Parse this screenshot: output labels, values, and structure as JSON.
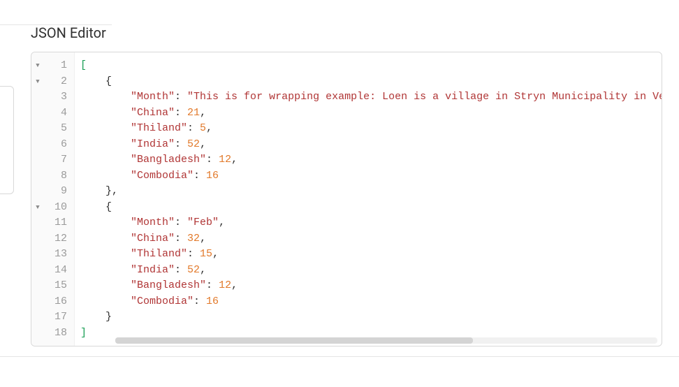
{
  "title": "JSON Editor",
  "lines": [
    {
      "n": 1,
      "fold": true,
      "ind": 0,
      "tokens": [
        {
          "t": "[",
          "c": "bracket"
        }
      ]
    },
    {
      "n": 2,
      "fold": true,
      "ind": 1,
      "tokens": [
        {
          "t": "{",
          "c": "brace"
        }
      ]
    },
    {
      "n": 3,
      "fold": false,
      "ind": 2,
      "tokens": [
        {
          "t": "\"Month\"",
          "c": "key"
        },
        {
          "t": ": ",
          "c": "punc"
        },
        {
          "t": "\"This is for wrapping example: Loen is a village in Stryn Municipality in Vestland county, Norway.\"",
          "c": "str"
        },
        {
          "t": ",",
          "c": "punc"
        }
      ]
    },
    {
      "n": 4,
      "fold": false,
      "ind": 2,
      "tokens": [
        {
          "t": "\"China\"",
          "c": "key"
        },
        {
          "t": ": ",
          "c": "punc"
        },
        {
          "t": "21",
          "c": "num"
        },
        {
          "t": ",",
          "c": "punc"
        }
      ]
    },
    {
      "n": 5,
      "fold": false,
      "ind": 2,
      "tokens": [
        {
          "t": "\"Thiland\"",
          "c": "key"
        },
        {
          "t": ": ",
          "c": "punc"
        },
        {
          "t": "5",
          "c": "num"
        },
        {
          "t": ",",
          "c": "punc"
        }
      ]
    },
    {
      "n": 6,
      "fold": false,
      "ind": 2,
      "tokens": [
        {
          "t": "\"India\"",
          "c": "key"
        },
        {
          "t": ": ",
          "c": "punc"
        },
        {
          "t": "52",
          "c": "num"
        },
        {
          "t": ",",
          "c": "punc"
        }
      ]
    },
    {
      "n": 7,
      "fold": false,
      "ind": 2,
      "tokens": [
        {
          "t": "\"Bangladesh\"",
          "c": "key"
        },
        {
          "t": ": ",
          "c": "punc"
        },
        {
          "t": "12",
          "c": "num"
        },
        {
          "t": ",",
          "c": "punc"
        }
      ]
    },
    {
      "n": 8,
      "fold": false,
      "ind": 2,
      "tokens": [
        {
          "t": "\"Combodia\"",
          "c": "key"
        },
        {
          "t": ": ",
          "c": "punc"
        },
        {
          "t": "16",
          "c": "num"
        }
      ]
    },
    {
      "n": 9,
      "fold": false,
      "ind": 1,
      "tokens": [
        {
          "t": "},",
          "c": "brace"
        }
      ]
    },
    {
      "n": 10,
      "fold": true,
      "ind": 1,
      "tokens": [
        {
          "t": "{",
          "c": "brace"
        }
      ]
    },
    {
      "n": 11,
      "fold": false,
      "ind": 2,
      "tokens": [
        {
          "t": "\"Month\"",
          "c": "key"
        },
        {
          "t": ": ",
          "c": "punc"
        },
        {
          "t": "\"Feb\"",
          "c": "str"
        },
        {
          "t": ",",
          "c": "punc"
        }
      ]
    },
    {
      "n": 12,
      "fold": false,
      "ind": 2,
      "tokens": [
        {
          "t": "\"China\"",
          "c": "key"
        },
        {
          "t": ": ",
          "c": "punc"
        },
        {
          "t": "32",
          "c": "num"
        },
        {
          "t": ",",
          "c": "punc"
        }
      ]
    },
    {
      "n": 13,
      "fold": false,
      "ind": 2,
      "tokens": [
        {
          "t": "\"Thiland\"",
          "c": "key"
        },
        {
          "t": ": ",
          "c": "punc"
        },
        {
          "t": "15",
          "c": "num"
        },
        {
          "t": ",",
          "c": "punc"
        }
      ]
    },
    {
      "n": 14,
      "fold": false,
      "ind": 2,
      "tokens": [
        {
          "t": "\"India\"",
          "c": "key"
        },
        {
          "t": ": ",
          "c": "punc"
        },
        {
          "t": "52",
          "c": "num"
        },
        {
          "t": ",",
          "c": "punc"
        }
      ]
    },
    {
      "n": 15,
      "fold": false,
      "ind": 2,
      "tokens": [
        {
          "t": "\"Bangladesh\"",
          "c": "key"
        },
        {
          "t": ": ",
          "c": "punc"
        },
        {
          "t": "12",
          "c": "num"
        },
        {
          "t": ",",
          "c": "punc"
        }
      ]
    },
    {
      "n": 16,
      "fold": false,
      "ind": 2,
      "tokens": [
        {
          "t": "\"Combodia\"",
          "c": "key"
        },
        {
          "t": ": ",
          "c": "punc"
        },
        {
          "t": "16",
          "c": "num"
        }
      ]
    },
    {
      "n": 17,
      "fold": false,
      "ind": 1,
      "tokens": [
        {
          "t": "}",
          "c": "brace"
        }
      ]
    },
    {
      "n": 18,
      "fold": false,
      "ind": 0,
      "tokens": [
        {
          "t": "]",
          "c": "bracket"
        }
      ]
    }
  ],
  "fold_glyph": "▼"
}
